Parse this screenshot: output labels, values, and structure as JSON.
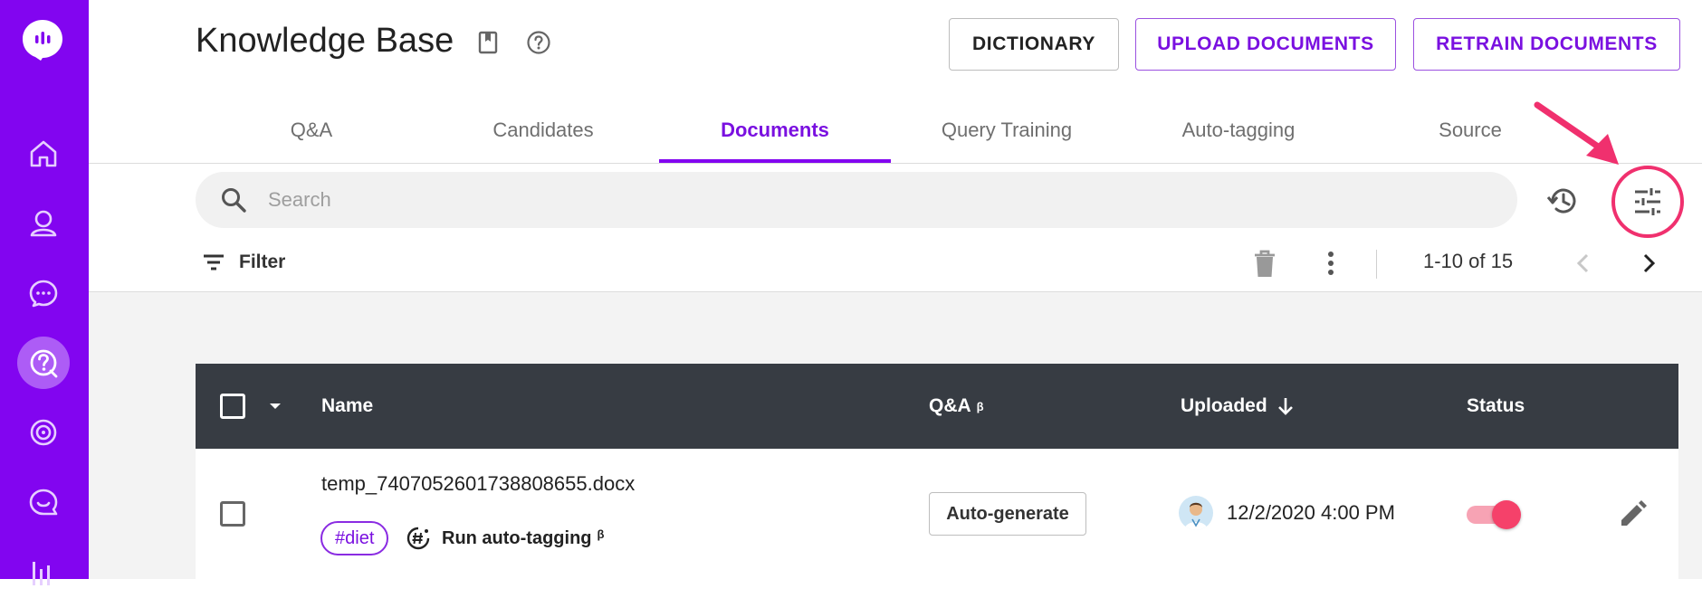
{
  "header": {
    "title": "Knowledge Base",
    "buttons": {
      "dictionary": "DICTIONARY",
      "upload": "UPLOAD DOCUMENTS",
      "retrain": "RETRAIN DOCUMENTS"
    }
  },
  "tabs": [
    {
      "label": "Q&A",
      "active": false
    },
    {
      "label": "Candidates",
      "active": false
    },
    {
      "label": "Documents",
      "active": true
    },
    {
      "label": "Query Training",
      "active": false
    },
    {
      "label": "Auto-tagging",
      "active": false
    },
    {
      "label": "Source",
      "active": false
    }
  ],
  "search": {
    "placeholder": "Search",
    "value": ""
  },
  "toolbar": {
    "filter_label": "Filter",
    "pagination": "1-10 of 15"
  },
  "table": {
    "columns": {
      "name": "Name",
      "qa": "Q&A",
      "qa_sup": "β",
      "uploaded": "Uploaded",
      "status": "Status"
    },
    "rows": [
      {
        "filename": "temp_7407052601738808655.docx",
        "tag": "#diet",
        "autotag_label": "Run auto-tagging",
        "autotag_sup": "β",
        "action": "Auto-generate",
        "uploaded": "12/2/2020 4:00 PM",
        "status_on": true
      }
    ]
  },
  "colors": {
    "brand": "#8205f0",
    "highlight": "#f0306e",
    "header_dark": "#373c43",
    "toggle_on": "#f5416a"
  },
  "sidebar": {
    "items": [
      "home-icon",
      "user-icon",
      "chat-icon",
      "knowledge-icon",
      "radar-icon",
      "messages-icon",
      "analytics-icon"
    ],
    "active": "knowledge-icon"
  }
}
